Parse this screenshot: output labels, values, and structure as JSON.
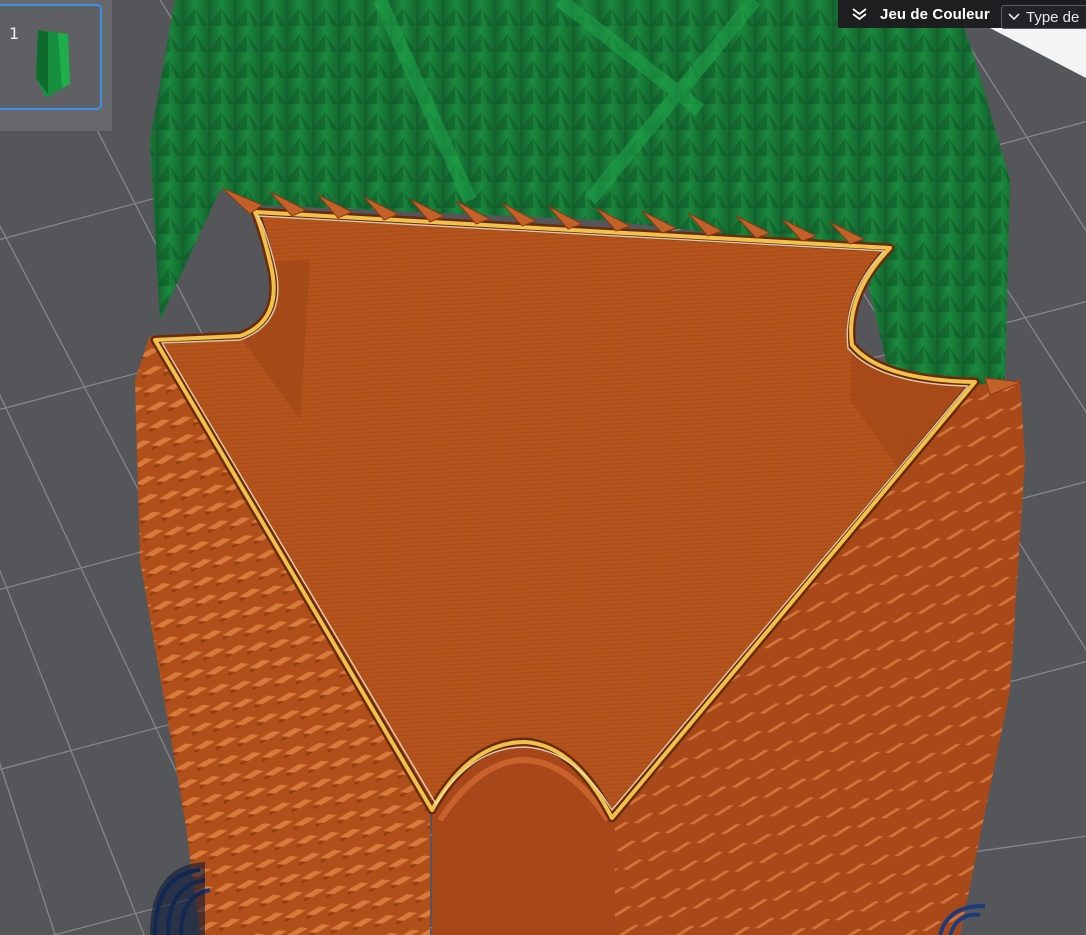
{
  "plate_list": {
    "items": [
      {
        "index": "1"
      }
    ]
  },
  "toolbar": {
    "color_scheme_label": "Jeu de Couleur",
    "view_type_label": "Type de",
    "collapse_icon": "double-chevron-down-icon",
    "select_icon": "chevron-down-icon"
  },
  "colors": {
    "background": "#54565a",
    "bed_grid": "#8a8c90",
    "model_filament": "#b4531c",
    "shadow_model": "#1c7a3a",
    "highlight_outer_wall": "#f0c14b",
    "selection_accent": "#3d8ee6",
    "top_bar": "#1d1e20",
    "support_base": "#1d3a7a"
  }
}
